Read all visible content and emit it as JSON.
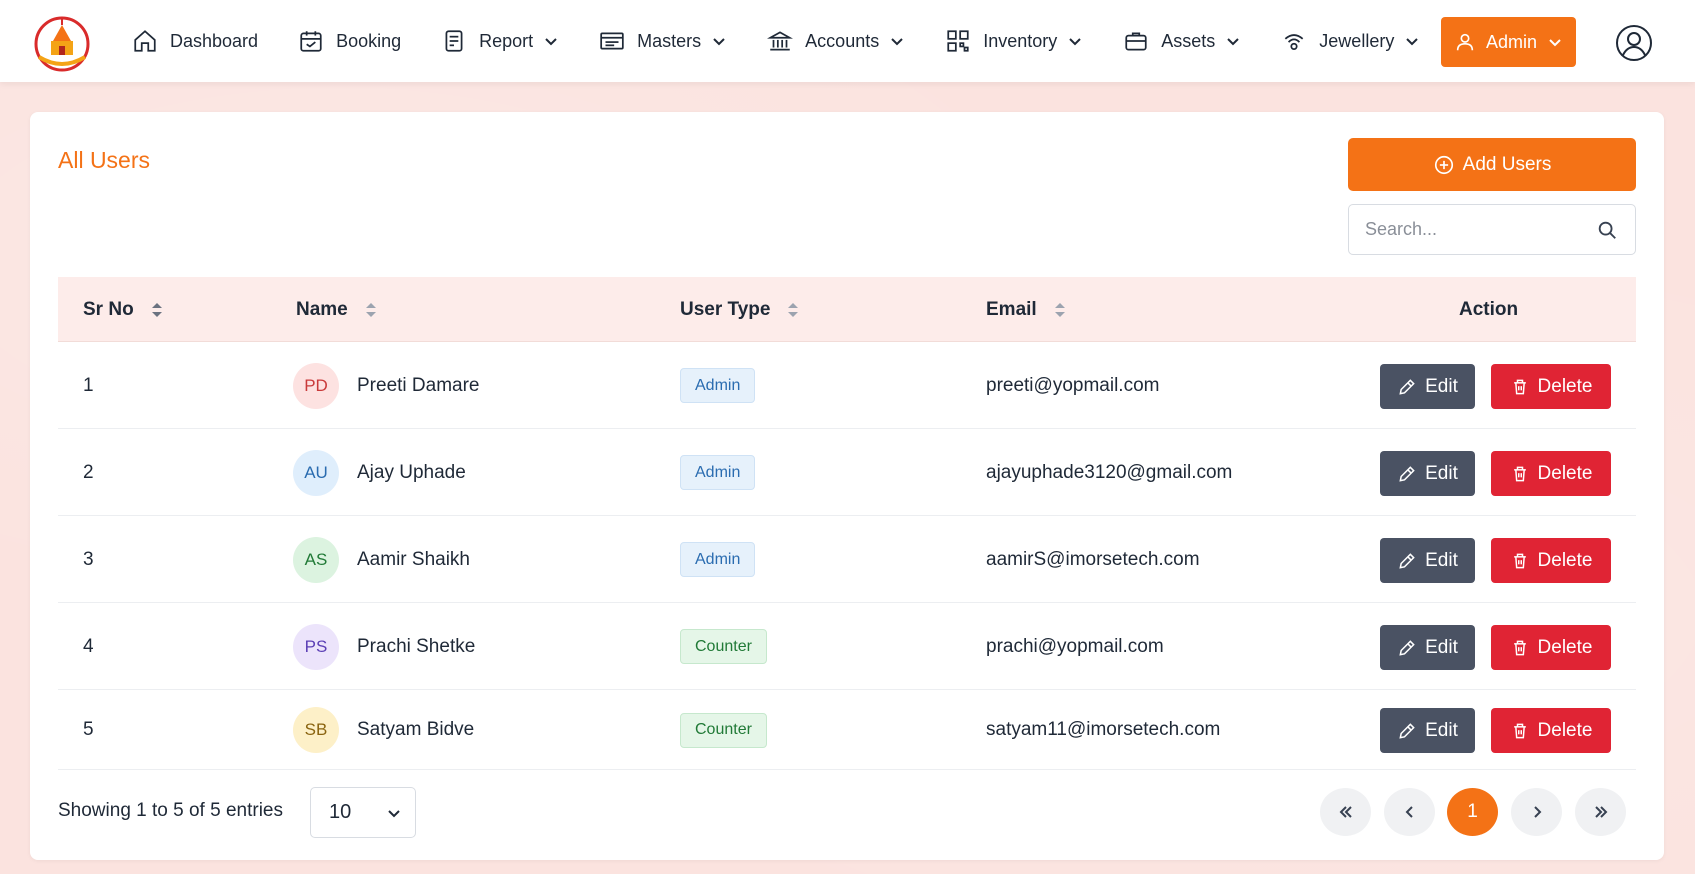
{
  "nav": {
    "items": [
      {
        "label": "Dashboard",
        "icon": "home-icon",
        "dropdown": false
      },
      {
        "label": "Booking",
        "icon": "calendar-icon",
        "dropdown": false
      },
      {
        "label": "Report",
        "icon": "report-icon",
        "dropdown": true
      },
      {
        "label": "Masters",
        "icon": "masters-icon",
        "dropdown": true
      },
      {
        "label": "Accounts",
        "icon": "bank-icon",
        "dropdown": true
      },
      {
        "label": "Inventory",
        "icon": "qr-icon",
        "dropdown": true
      },
      {
        "label": "Assets",
        "icon": "briefcase-icon",
        "dropdown": true
      },
      {
        "label": "Jewellery",
        "icon": "ring-icon",
        "dropdown": true
      }
    ],
    "admin_label": "Admin"
  },
  "page": {
    "title": "All Users",
    "add_button": "Add Users",
    "search_placeholder": "Search..."
  },
  "table": {
    "headers": [
      "Sr No",
      "Name",
      "User Type",
      "Email",
      "Action"
    ],
    "edit_label": "Edit",
    "delete_label": "Delete",
    "rows": [
      {
        "sr": "1",
        "initials": "PD",
        "name": "Preeti Damare",
        "type": "Admin",
        "email": "preeti@yopmail.com"
      },
      {
        "sr": "2",
        "initials": "AU",
        "name": "Ajay Uphade",
        "type": "Admin",
        "email": "ajayuphade3120@gmail.com"
      },
      {
        "sr": "3",
        "initials": "AS",
        "name": "Aamir Shaikh",
        "type": "Admin",
        "email": "aamirS@imorsetech.com"
      },
      {
        "sr": "4",
        "initials": "PS",
        "name": "Prachi Shetke",
        "type": "Counter",
        "email": "prachi@yopmail.com"
      },
      {
        "sr": "5",
        "initials": "SB",
        "name": "Satyam Bidve",
        "type": "Counter",
        "email": "satyam11@imorsetech.com"
      }
    ]
  },
  "footer": {
    "showing": "Showing 1 to 5 of 5 entries",
    "page_size": "10",
    "current_page": "1"
  },
  "colors": {
    "accent": "#f47216",
    "edit": "#4a5263",
    "delete": "#e02434"
  }
}
